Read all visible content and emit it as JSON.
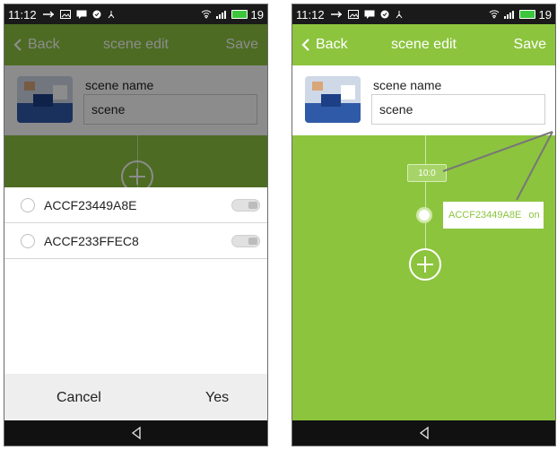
{
  "statusbar": {
    "time": "11:12",
    "battery_text": "19"
  },
  "left_phone": {
    "back_label": "Back",
    "title": "scene edit",
    "save_label": "Save",
    "scene_label": "scene name",
    "scene_value": "scene",
    "devices": [
      {
        "name": "ACCF23449A8E"
      },
      {
        "name": "ACCF233FFEC8"
      }
    ],
    "cancel_label": "Cancel",
    "yes_label": "Yes"
  },
  "right_phone": {
    "back_label": "Back",
    "title": "scene edit",
    "save_label": "Save",
    "scene_label": "scene name",
    "scene_value": "scene",
    "time_chip": "10:0",
    "device_bubble_name": "ACCF23449A8E",
    "device_bubble_state": "on"
  },
  "colors": {
    "accent": "#8cc43e",
    "status_bar": "#1a1a1a",
    "nav_bar": "#111111"
  }
}
